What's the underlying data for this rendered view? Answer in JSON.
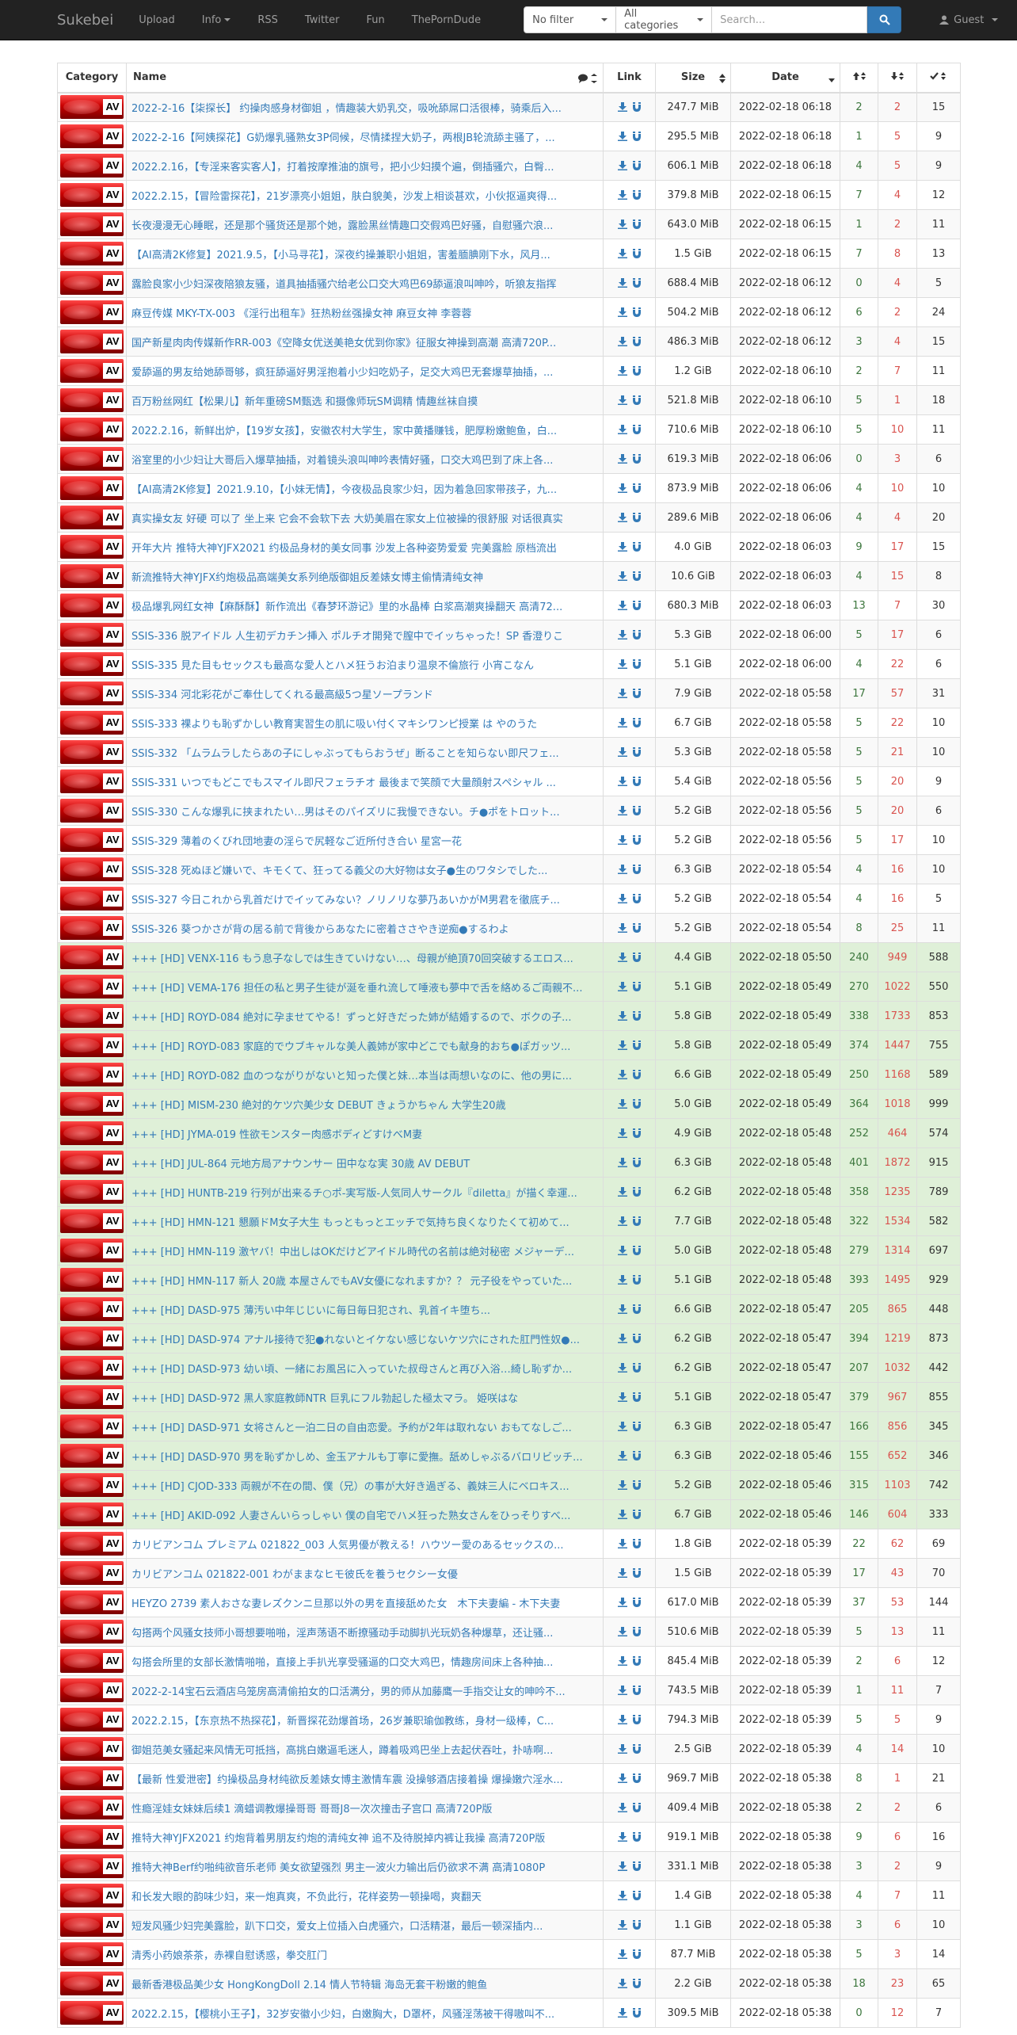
{
  "nav": {
    "brand": "Sukebei",
    "links": [
      "Upload",
      "Info",
      "RSS",
      "Twitter",
      "Fun",
      "ThePornDude"
    ],
    "filter_select": "No filter",
    "category_select": "All categories",
    "search_placeholder": "Search...",
    "user": "Guest"
  },
  "headers": {
    "category": "Category",
    "name": "Name",
    "link": "Link",
    "size": "Size",
    "date": "Date"
  },
  "category_label": "AV",
  "colors": {
    "accent": "#337ab7",
    "navbar": "#222222",
    "success_row": "#dff0d8",
    "seeders": "#3c763d",
    "leechers": "#d9534f"
  },
  "rows": [
    {
      "name": "2022-2-16【柒探长】 约操肉感身材御姐 ，情趣装大奶乳交，吸吮舔屌口活很棒，骑乘后入...",
      "size": "247.7 MiB",
      "date": "2022-02-18 06:18",
      "s": "2",
      "l": "2",
      "c": "15",
      "t": "default"
    },
    {
      "name": "2022-2-16【阿姨探花】G奶爆乳骚熟女3P伺候，尽情揉捏大奶子，两根JB轮流舔主骚了，...",
      "size": "295.5 MiB",
      "date": "2022-02-18 06:18",
      "s": "1",
      "l": "5",
      "c": "9",
      "t": "default"
    },
    {
      "name": "2022.2.16，【专淫来客实客人】，打着按摩推油的旗号，把小少妇摸个遍，倒插骚穴，白臀...",
      "size": "606.1 MiB",
      "date": "2022-02-18 06:18",
      "s": "4",
      "l": "5",
      "c": "9",
      "t": "default"
    },
    {
      "name": "2022.2.15，【冒险雷探花】，21岁漂亮小姐姐，肤白貌美，沙发上相谈甚欢，小伙抠逼爽得...",
      "size": "379.8 MiB",
      "date": "2022-02-18 06:15",
      "s": "7",
      "l": "4",
      "c": "12",
      "t": "default"
    },
    {
      "name": "长夜漫漫无心睡眠，还是那个骚货还是那个她，露脸黑丝情趣口交假鸡巴好骚，自慰骚穴浪...",
      "size": "643.0 MiB",
      "date": "2022-02-18 06:15",
      "s": "1",
      "l": "2",
      "c": "11",
      "t": "default"
    },
    {
      "name": "【AI高清2K修复】2021.9.5，【小马寻花】，深夜约操兼职小姐姐，害羞腼腆刚下水，风月...",
      "size": "1.5 GiB",
      "date": "2022-02-18 06:15",
      "s": "7",
      "l": "8",
      "c": "13",
      "t": "default"
    },
    {
      "name": "露脸良家小少妇深夜陪狼友骚，道具抽插骚穴给老公口交大鸡巴69舔逼浪叫呻吟，听狼友指挥",
      "size": "688.4 MiB",
      "date": "2022-02-18 06:12",
      "s": "0",
      "l": "4",
      "c": "5",
      "t": "default"
    },
    {
      "name": "麻豆传媒 MKY-TX-003 《淫行出租车》狂热粉丝强操女神 麻豆女神 李蓉蓉",
      "size": "504.2 MiB",
      "date": "2022-02-18 06:12",
      "s": "6",
      "l": "2",
      "c": "24",
      "t": "default"
    },
    {
      "name": "国产新星肉肉传媒新作RR-003《空降女优送美艳女优到你家》征服女神操到高潮 高清720P...",
      "size": "486.3 MiB",
      "date": "2022-02-18 06:12",
      "s": "3",
      "l": "4",
      "c": "15",
      "t": "default"
    },
    {
      "name": "爱舔逼的男友给她舔哥够，疯狂舔逼好男淫抱着小少妇吃奶子，足交大鸡巴无套爆草抽插，...",
      "size": "1.2 GiB",
      "date": "2022-02-18 06:10",
      "s": "2",
      "l": "7",
      "c": "11",
      "t": "default"
    },
    {
      "name": "百万粉丝网红【松果儿】新年重磅SM甄选 和摄像师玩SM调精 情趣丝袜自摸",
      "size": "521.8 MiB",
      "date": "2022-02-18 06:10",
      "s": "5",
      "l": "1",
      "c": "18",
      "t": "default"
    },
    {
      "name": "2022.2.16，新鲜出炉，【19岁女孩】，安徽农村大学生，家中黄播赚钱，肥厚粉嫩鲍鱼，白...",
      "size": "710.6 MiB",
      "date": "2022-02-18 06:10",
      "s": "5",
      "l": "10",
      "c": "11",
      "t": "default"
    },
    {
      "name": "浴室里的小少妇让大哥后入爆草抽插，对着镜头浪叫呻吟表情好骚，口交大鸡巴到了床上各...",
      "size": "619.3 MiB",
      "date": "2022-02-18 06:06",
      "s": "0",
      "l": "3",
      "c": "6",
      "t": "default"
    },
    {
      "name": "【AI高清2K修复】2021.9.10，【小妹无情】，今夜极品良家少妇，因为着急回家带孩子，九...",
      "size": "873.9 MiB",
      "date": "2022-02-18 06:06",
      "s": "4",
      "l": "10",
      "c": "10",
      "t": "default"
    },
    {
      "name": "真实操女友 好硬 可以了 坐上来 它会不会软下去 大奶美眉在家女上位被操的很舒服 对话很真实",
      "size": "289.6 MiB",
      "date": "2022-02-18 06:06",
      "s": "4",
      "l": "4",
      "c": "20",
      "t": "default"
    },
    {
      "name": "开年大片 推特大神YJFX2021 约极品身材的美女同事 沙发上各种姿势爱爱 完美露脸 原档流出",
      "size": "4.0 GiB",
      "date": "2022-02-18 06:03",
      "s": "9",
      "l": "17",
      "c": "15",
      "t": "default"
    },
    {
      "name": "新流推特大神YJFX约炮极品高端美女系列绝版御姐反差婊女博主偷情清纯女神",
      "size": "10.6 GiB",
      "date": "2022-02-18 06:03",
      "s": "4",
      "l": "15",
      "c": "8",
      "t": "default"
    },
    {
      "name": "极品爆乳网红女神【麻酥酥】新作流出《春梦环游记》里的水晶棒 白浆高潮爽操翻天 高清72...",
      "size": "680.3 MiB",
      "date": "2022-02-18 06:03",
      "s": "13",
      "l": "7",
      "c": "30",
      "t": "default"
    },
    {
      "name": "SSIS-336 脱アイドル 人生初デカチン挿入 ポルチオ開発で膣中でイッちゃった！SP 香澄りこ",
      "size": "5.3 GiB",
      "date": "2022-02-18 06:00",
      "s": "5",
      "l": "17",
      "c": "6",
      "t": "default"
    },
    {
      "name": "SSIS-335 見た目もセックスも最高な愛人とハメ狂うお泊まり温泉不倫旅行 小宵こなん",
      "size": "5.1 GiB",
      "date": "2022-02-18 06:00",
      "s": "4",
      "l": "22",
      "c": "6",
      "t": "default"
    },
    {
      "name": "SSIS-334 河北彩花がご奉仕してくれる最高級5つ星ソープランド",
      "size": "7.9 GiB",
      "date": "2022-02-18 05:58",
      "s": "17",
      "l": "57",
      "c": "31",
      "t": "default"
    },
    {
      "name": "SSIS-333 裸よりも恥ずかしい教育実習生の肌に吸い付くマキシワンピ授業 は やのうた",
      "size": "6.7 GiB",
      "date": "2022-02-18 05:58",
      "s": "5",
      "l": "22",
      "c": "10",
      "t": "default"
    },
    {
      "name": "SSIS-332 「ムラムラしたらあの子にしゃぶってもらおうぜ」断ることを知らない即尺フェ...",
      "size": "5.3 GiB",
      "date": "2022-02-18 05:58",
      "s": "5",
      "l": "21",
      "c": "10",
      "t": "default"
    },
    {
      "name": "SSIS-331 いつでもどこでもスマイル即尺フェラチオ 最後まで笑顔で大量顔射スペシャル ...",
      "size": "5.4 GiB",
      "date": "2022-02-18 05:56",
      "s": "5",
      "l": "20",
      "c": "9",
      "t": "default"
    },
    {
      "name": "SSIS-330 こんな爆乳に挟まれたい…男はそのパイズリに我慢できない。チ●ポをトロット...",
      "size": "5.2 GiB",
      "date": "2022-02-18 05:56",
      "s": "5",
      "l": "20",
      "c": "6",
      "t": "default"
    },
    {
      "name": "SSIS-329 薄着のくびれ団地妻の淫らで尻軽なご近所付き合い 星宮一花",
      "size": "5.2 GiB",
      "date": "2022-02-18 05:56",
      "s": "5",
      "l": "17",
      "c": "10",
      "t": "default"
    },
    {
      "name": "SSIS-328 死ぬほど嫌いで、キモくて、狂ってる義父の大好物は女子●生のワタシでした...",
      "size": "6.3 GiB",
      "date": "2022-02-18 05:54",
      "s": "4",
      "l": "16",
      "c": "10",
      "t": "default"
    },
    {
      "name": "SSIS-327 今日これから乳首だけでイッてみない？ノリノリな夢乃あいかがM男君を徹底チ...",
      "size": "5.2 GiB",
      "date": "2022-02-18 05:54",
      "s": "4",
      "l": "16",
      "c": "5",
      "t": "default"
    },
    {
      "name": "SSIS-326 葵つかさが背の居る前で背後からあなたに密着ささやき逆痴●するわよ",
      "size": "5.2 GiB",
      "date": "2022-02-18 05:54",
      "s": "8",
      "l": "25",
      "c": "11",
      "t": "default"
    },
    {
      "name": "+++ [HD] VENX-116 もう息子なしでは生きていけない…、母親が絶頂70回突破するエロス...",
      "size": "4.4 GiB",
      "date": "2022-02-18 05:50",
      "s": "240",
      "l": "949",
      "c": "588",
      "t": "success"
    },
    {
      "name": "+++ [HD] VEMA-176 担任の私と男子生徒が涎を垂れ流して唾液も夢中で舌を絡めるご両親不...",
      "size": "5.1 GiB",
      "date": "2022-02-18 05:49",
      "s": "270",
      "l": "1022",
      "c": "550",
      "t": "success"
    },
    {
      "name": "+++ [HD] ROYD-084 絶対に孕ませてやる！ずっと好きだった姉が結婚するので、ボクの子...",
      "size": "5.8 GiB",
      "date": "2022-02-18 05:49",
      "s": "338",
      "l": "1733",
      "c": "853",
      "t": "success"
    },
    {
      "name": "+++ [HD] ROYD-083 家庭的でウブキャルな美人義姉が家中どこでも献身的おち●ぽガッツ...",
      "size": "5.8 GiB",
      "date": "2022-02-18 05:49",
      "s": "374",
      "l": "1447",
      "c": "755",
      "t": "success"
    },
    {
      "name": "+++ [HD] ROYD-082 血のつながりがないと知った僕と妹…本当は両想いなのに、他の男に...",
      "size": "6.6 GiB",
      "date": "2022-02-18 05:49",
      "s": "250",
      "l": "1168",
      "c": "589",
      "t": "success"
    },
    {
      "name": "+++ [HD] MISM-230 絶対的ケツ穴美少女 DEBUT きょうかちゃん 大学生20歳",
      "size": "5.0 GiB",
      "date": "2022-02-18 05:49",
      "s": "364",
      "l": "1018",
      "c": "999",
      "t": "success"
    },
    {
      "name": "+++ [HD] JYMA-019 性欲モンスター肉感ボディどすけべM妻",
      "size": "4.9 GiB",
      "date": "2022-02-18 05:48",
      "s": "252",
      "l": "464",
      "c": "574",
      "t": "success"
    },
    {
      "name": "+++ [HD] JUL-864 元地方局アナウンサー 田中なな実 30歳 AV DEBUT",
      "size": "6.3 GiB",
      "date": "2022-02-18 05:48",
      "s": "401",
      "l": "1872",
      "c": "915",
      "t": "success"
    },
    {
      "name": "+++ [HD] HUNTB-219 行列が出来るチ○ポ-実写版-人気同人サークル『diletta』が描く幸運...",
      "size": "6.2 GiB",
      "date": "2022-02-18 05:48",
      "s": "358",
      "l": "1235",
      "c": "789",
      "t": "success"
    },
    {
      "name": "+++ [HD] HMN-121 懇願ドM女子大生 もっともっとエッチで気持ち良くなりたくて初めて...",
      "size": "7.7 GiB",
      "date": "2022-02-18 05:48",
      "s": "322",
      "l": "1534",
      "c": "582",
      "t": "success"
    },
    {
      "name": "+++ [HD] HMN-119 激ヤバ！中出しはOKだけどアイドル時代の名前は絶対秘密 メジャーデ...",
      "size": "5.0 GiB",
      "date": "2022-02-18 05:48",
      "s": "279",
      "l": "1314",
      "c": "697",
      "t": "success"
    },
    {
      "name": "+++ [HD] HMN-117 新人 20歳 本屋さんでもAV女優になれますか？？ 元子役をやっていた...",
      "size": "5.1 GiB",
      "date": "2022-02-18 05:48",
      "s": "393",
      "l": "1495",
      "c": "929",
      "t": "success"
    },
    {
      "name": "+++ [HD] DASD-975 薄汚い中年じじいに毎日毎日犯され、乳首イキ堕ち...",
      "size": "6.6 GiB",
      "date": "2022-02-18 05:47",
      "s": "205",
      "l": "865",
      "c": "448",
      "t": "success"
    },
    {
      "name": "+++ [HD] DASD-974 アナル接待で犯●れないとイケない感じないケツ穴にされた肛門性奴●...",
      "size": "6.2 GiB",
      "date": "2022-02-18 05:47",
      "s": "394",
      "l": "1219",
      "c": "873",
      "t": "success"
    },
    {
      "name": "+++ [HD] DASD-973 幼い頃、一緒にお風呂に入っていた叔母さんと再び入浴…綺し恥ずか...",
      "size": "6.2 GiB",
      "date": "2022-02-18 05:47",
      "s": "207",
      "l": "1032",
      "c": "442",
      "t": "success"
    },
    {
      "name": "+++ [HD] DASD-972 黒人家庭教師NTR 巨乳にフル勃起した極太マラ。 姫咲はな",
      "size": "5.1 GiB",
      "date": "2022-02-18 05:47",
      "s": "379",
      "l": "967",
      "c": "855",
      "t": "success"
    },
    {
      "name": "+++ [HD] DASD-971 女将さんと一泊二日の自由恋愛。予約が2年は取れない おもてなしご...",
      "size": "6.3 GiB",
      "date": "2022-02-18 05:47",
      "s": "166",
      "l": "856",
      "c": "345",
      "t": "success"
    },
    {
      "name": "+++ [HD] DASD-970 男を恥ずかしめ、金玉アナルも丁寧に愛撫。舐めしゃぶるバロリビッチ...",
      "size": "6.3 GiB",
      "date": "2022-02-18 05:46",
      "s": "155",
      "l": "652",
      "c": "346",
      "t": "success"
    },
    {
      "name": "+++ [HD] CJOD-333 両親が不在の間、僕（兄）の事が大好き過ぎる、義妹三人にベロキス...",
      "size": "5.2 GiB",
      "date": "2022-02-18 05:46",
      "s": "315",
      "l": "1103",
      "c": "742",
      "t": "success"
    },
    {
      "name": "+++ [HD] AKID-092 人妻さんいらっしゃい 僕の自宅でハメ狂った熟女さんをひっそりすべ...",
      "size": "6.7 GiB",
      "date": "2022-02-18 05:46",
      "s": "146",
      "l": "604",
      "c": "333",
      "t": "success"
    },
    {
      "name": "カリビアンコム プレミアム 021822_003 人気男優が教える！ハウツー愛のあるセックスの...",
      "size": "1.8 GiB",
      "date": "2022-02-18 05:39",
      "s": "22",
      "l": "62",
      "c": "69",
      "t": "default"
    },
    {
      "name": "カリビアンコム 021822-001 わがままなヒモ彼氏を養うセクシー女優",
      "size": "1.5 GiB",
      "date": "2022-02-18 05:39",
      "s": "17",
      "l": "43",
      "c": "70",
      "t": "default"
    },
    {
      "name": "HEYZO 2739 素人おさな妻レズクンニ旦那以外の男を直接舐めた女　木下夫妻編 - 木下夫妻",
      "size": "617.0 MiB",
      "date": "2022-02-18 05:39",
      "s": "37",
      "l": "53",
      "c": "144",
      "t": "default"
    },
    {
      "name": "勾搭两个风骚女技师小哥想要啪啪，淫声荡语不断撩骚动手动脚扒光玩奶各种爆草，还让骚...",
      "size": "510.6 MiB",
      "date": "2022-02-18 05:39",
      "s": "5",
      "l": "13",
      "c": "11",
      "t": "default"
    },
    {
      "name": "勾搭会所里的女部长激情啪啪，直接上手扒光享受骚逼的口交大鸡巴，情趣房间床上各种抽...",
      "size": "845.4 MiB",
      "date": "2022-02-18 05:39",
      "s": "2",
      "l": "6",
      "c": "12",
      "t": "default"
    },
    {
      "name": "2022-2-14宝石云酒店乌笼房高清偷拍女的口活满分，男的师从加藤鹰一手指交让女的呻吟不...",
      "size": "743.5 MiB",
      "date": "2022-02-18 05:39",
      "s": "1",
      "l": "11",
      "c": "7",
      "t": "default"
    },
    {
      "name": "2022.2.15，【东京热不热探花】，新晋探花劲爆首场，26岁兼职瑜伽教练，身材一级棒，C...",
      "size": "794.3 MiB",
      "date": "2022-02-18 05:39",
      "s": "5",
      "l": "5",
      "c": "9",
      "t": "default"
    },
    {
      "name": "御姐范美女骚起来风情无可抵挡，高挑白嫩逼毛迷人，蹲着吸鸡巴坐上去起伏吞吐，扑哧啊...",
      "size": "2.5 GiB",
      "date": "2022-02-18 05:39",
      "s": "4",
      "l": "14",
      "c": "10",
      "t": "default"
    },
    {
      "name": "【最新 性爱泄密】约操极品身材纯欲反差婊女博主激情车震 没操够酒店接着操 爆操嫩穴淫水...",
      "size": "969.7 MiB",
      "date": "2022-02-18 05:38",
      "s": "8",
      "l": "1",
      "c": "21",
      "t": "default"
    },
    {
      "name": "性瘾淫娃女妹妹后续1 滴蜡调教爆操哥哥 哥哥J8一次次撞击子宫口 高清720P版",
      "size": "409.4 MiB",
      "date": "2022-02-18 05:38",
      "s": "2",
      "l": "2",
      "c": "6",
      "t": "default"
    },
    {
      "name": "推特大神YJFX2021 约炮背着男朋友约炮的清纯女神 追不及待脱掉内裤让我操 高清720P版",
      "size": "919.1 MiB",
      "date": "2022-02-18 05:38",
      "s": "9",
      "l": "6",
      "c": "16",
      "t": "default"
    },
    {
      "name": "推特大神Berf约啪纯欲音乐老师 美女欲望强烈 男主一波火力输出后仍欲求不满 高清1080P",
      "size": "331.1 MiB",
      "date": "2022-02-18 05:38",
      "s": "3",
      "l": "2",
      "c": "9",
      "t": "default"
    },
    {
      "name": "和长发大眼的韵味少妇，来一炮真爽，不负此行，花样姿势一顿操喝，爽翻天",
      "size": "1.4 GiB",
      "date": "2022-02-18 05:38",
      "s": "4",
      "l": "7",
      "c": "11",
      "t": "default"
    },
    {
      "name": "短发风骚少妇完美露脸，趴下口交，爱女上位插入白虎骚穴，口活精湛，最后一顿深插内...",
      "size": "1.1 GiB",
      "date": "2022-02-18 05:38",
      "s": "3",
      "l": "6",
      "c": "10",
      "t": "default"
    },
    {
      "name": "清秀小药娘茶茶，赤裸自慰诱惑，拳交肛门",
      "size": "87.7 MiB",
      "date": "2022-02-18 05:38",
      "s": "5",
      "l": "3",
      "c": "14",
      "t": "default"
    },
    {
      "name": "最新香港极品美少女 HongKongDoll 2.14 情人节特辑 海岛无套干粉嫩的鲍鱼",
      "size": "2.2 GiB",
      "date": "2022-02-18 05:38",
      "s": "18",
      "l": "23",
      "c": "65",
      "t": "default"
    },
    {
      "name": "2022.2.15，【樱桃小王子】，32岁安徽小少妇，白嫩胸大，D罩杯，风骚淫荡被干得嗷叫不...",
      "size": "309.5 MiB",
      "date": "2022-02-18 05:38",
      "s": "0",
      "l": "12",
      "c": "7",
      "t": "default"
    }
  ]
}
